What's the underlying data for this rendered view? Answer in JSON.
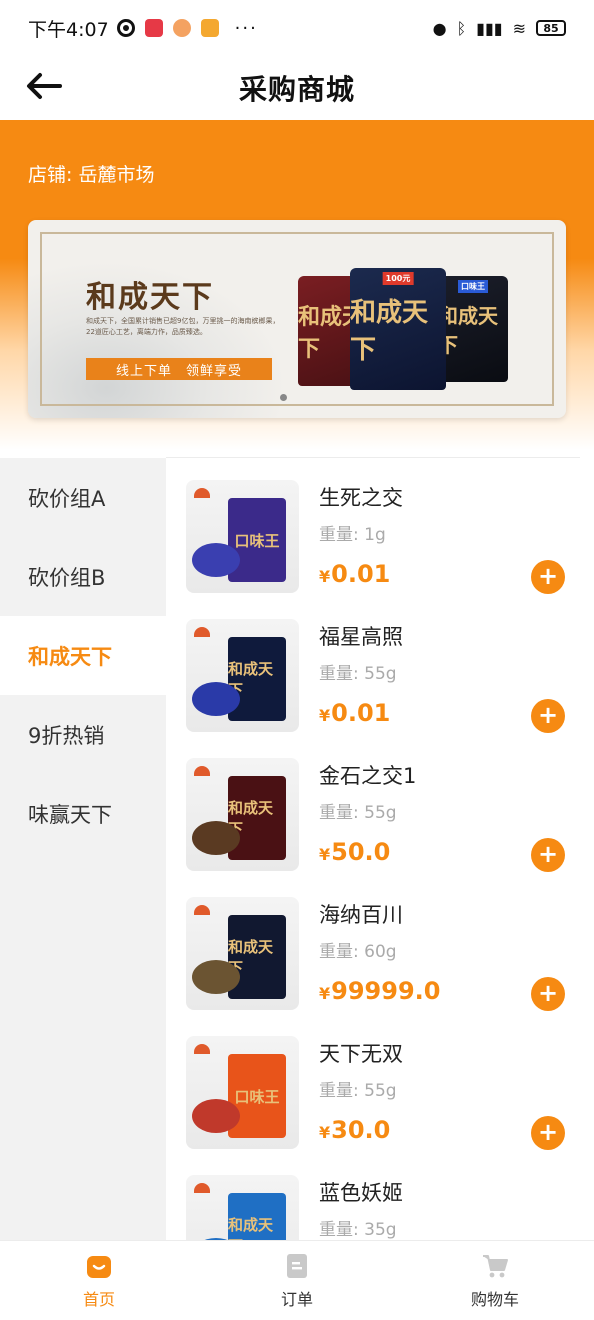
{
  "status_bar": {
    "time": "下午4:07",
    "more": "···",
    "battery": "85"
  },
  "nav": {
    "title": "采购商城"
  },
  "store": {
    "label": "店铺: 岳麓市场"
  },
  "banner": {
    "title": "和成天下",
    "description": "和成天下，全国累计销售已超9亿包，万里挑一的海南槟榔果，22道匠心工艺，离端力作，品质臻选。",
    "cta": "线上下单　领鲜享受",
    "bag_texts": [
      "和成天下",
      "和成天下",
      "和成天下"
    ],
    "bag_tags": [
      "100元",
      "口味王"
    ]
  },
  "categories": [
    {
      "label": "砍价组A",
      "active": false
    },
    {
      "label": "砍价组B",
      "active": false
    },
    {
      "label": "和成天下",
      "active": true
    },
    {
      "label": "9折热销",
      "active": false
    },
    {
      "label": "味赢天下",
      "active": false
    }
  ],
  "products": [
    {
      "name": "生死之交",
      "weight": "重量: 1g",
      "currency": "¥",
      "price": "0.01",
      "pack_color": "#3b2a8a",
      "pack_text": "口味王",
      "snack_color": "#3a3fb0"
    },
    {
      "name": "福星高照",
      "weight": "重量: 55g",
      "currency": "¥",
      "price": "0.01",
      "pack_color": "#0f1a3c",
      "pack_text": "和成天下",
      "snack_color": "#2a3aa8"
    },
    {
      "name": "金石之交1",
      "weight": "重量: 55g",
      "currency": "¥",
      "price": "50.0",
      "pack_color": "#4a1114",
      "pack_text": "和成天下",
      "snack_color": "#5a3a22"
    },
    {
      "name": "海纳百川",
      "weight": "重量: 60g",
      "currency": "¥",
      "price": "99999.0",
      "pack_color": "#111830",
      "pack_text": "和成天下",
      "snack_color": "#6b5432"
    },
    {
      "name": "天下无双",
      "weight": "重量: 55g",
      "currency": "¥",
      "price": "30.0",
      "pack_color": "#e8541a",
      "pack_text": "口味王",
      "snack_color": "#c0392b"
    },
    {
      "name": "蓝色妖姬",
      "weight": "重量: 35g",
      "currency": "¥",
      "price": "",
      "pack_color": "#1f6fc4",
      "pack_text": "和成天下",
      "snack_color": "#1f6fc4"
    }
  ],
  "tabs": [
    {
      "label": "首页",
      "active": true
    },
    {
      "label": "订单",
      "active": false
    },
    {
      "label": "购物车",
      "active": false
    }
  ],
  "colors": {
    "accent": "#f68a12"
  }
}
